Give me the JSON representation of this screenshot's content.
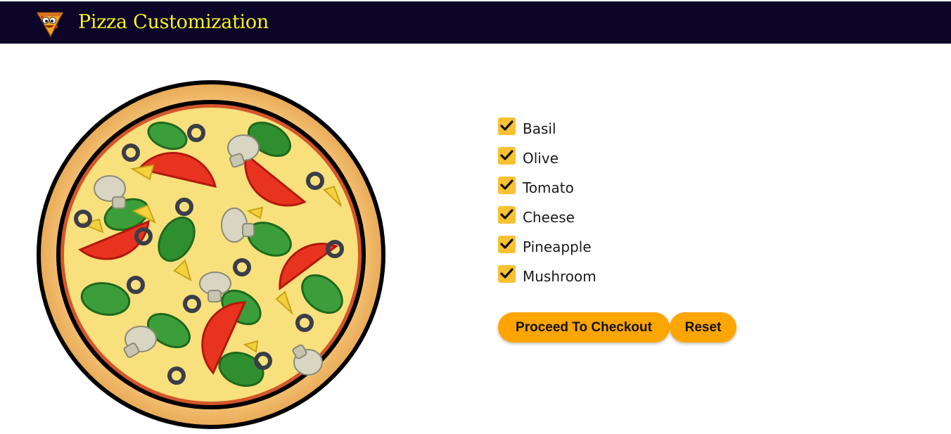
{
  "header": {
    "title": "Pizza Customization",
    "logo_icon": "pizza-slice-icon",
    "background": "#0c0527",
    "title_color": "#f9f21e"
  },
  "pizza": {
    "image_icon": "pizza-illustration"
  },
  "toppings": [
    {
      "label": "Basil",
      "checked": true
    },
    {
      "label": "Olive",
      "checked": true
    },
    {
      "label": "Tomato",
      "checked": true
    },
    {
      "label": "Cheese",
      "checked": true
    },
    {
      "label": "Pineapple",
      "checked": true
    },
    {
      "label": "Mushroom",
      "checked": true
    }
  ],
  "checkbox_color": "#f9c133",
  "actions": {
    "checkout_label": "Proceed To Checkout",
    "reset_label": "Reset",
    "button_color": "#ffa500"
  }
}
